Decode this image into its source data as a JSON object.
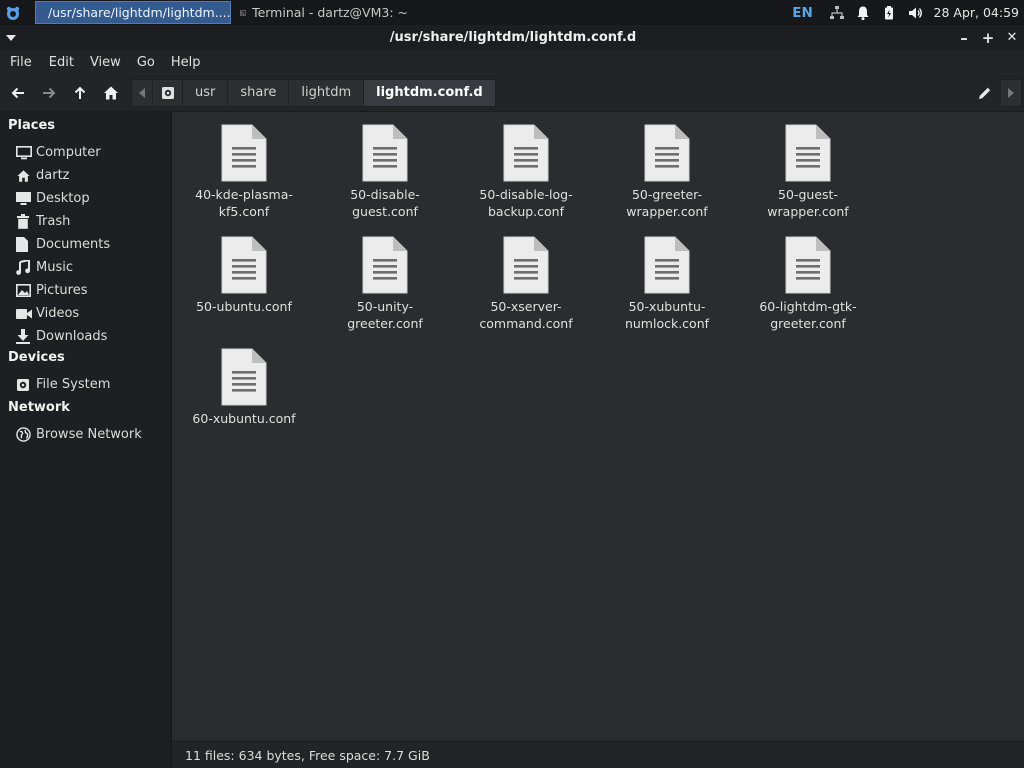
{
  "panel": {
    "active_task": "/usr/share/lightdm/lightdm....",
    "inactive_task": "Terminal - dartz@VM3: ~",
    "keyboard_layout": "EN",
    "clock": "28 Apr, 04:59"
  },
  "window": {
    "title": "/usr/share/lightdm/lightdm.conf.d",
    "minimize": "–",
    "maximize": "+",
    "close": "✕"
  },
  "menubar": [
    "File",
    "Edit",
    "View",
    "Go",
    "Help"
  ],
  "pathbar": {
    "crumbs": [
      "usr",
      "share",
      "lightdm",
      "lightdm.conf.d"
    ]
  },
  "sidebar": {
    "places_heading": "Places",
    "places": [
      {
        "label": "Computer",
        "icon": "computer-icon"
      },
      {
        "label": "dartz",
        "icon": "home-icon"
      },
      {
        "label": "Desktop",
        "icon": "desktop-icon"
      },
      {
        "label": "Trash",
        "icon": "trash-icon"
      },
      {
        "label": "Documents",
        "icon": "documents-icon"
      },
      {
        "label": "Music",
        "icon": "music-icon"
      },
      {
        "label": "Pictures",
        "icon": "pictures-icon"
      },
      {
        "label": "Videos",
        "icon": "videos-icon"
      },
      {
        "label": "Downloads",
        "icon": "downloads-icon"
      }
    ],
    "devices_heading": "Devices",
    "devices": [
      {
        "label": "File System",
        "icon": "drive-icon"
      }
    ],
    "network_heading": "Network",
    "network": [
      {
        "label": "Browse Network",
        "icon": "network-icon"
      }
    ]
  },
  "files": [
    "40-kde-plasma-kf5.conf",
    "50-disable-guest.conf",
    "50-disable-log-backup.conf",
    "50-greeter-wrapper.conf",
    "50-guest-wrapper.conf",
    "50-ubuntu.conf",
    "50-unity-greeter.conf",
    "50-xserver-command.conf",
    "50-xubuntu-numlock.conf",
    "60-lightdm-gtk-greeter.conf",
    "60-xubuntu.conf"
  ],
  "file_display_names": [
    [
      "40-kde-plasma-",
      "kf5.conf"
    ],
    [
      "50-disable-guest.conf"
    ],
    [
      "50-disable-log-",
      "backup.conf"
    ],
    [
      "50-greeter-",
      "wrapper.conf"
    ],
    [
      "50-guest-wrapper.conf"
    ],
    [
      "50-ubuntu.conf"
    ],
    [
      "50-unity-greeter.conf"
    ],
    [
      "50-xserver-",
      "command.conf"
    ],
    [
      "50-xubuntu-",
      "numlock.conf"
    ],
    [
      "60-lightdm-gtk-",
      "greeter.conf"
    ],
    [
      "60-xubuntu.conf"
    ]
  ],
  "statusbar": {
    "text": "11 files: 634 bytes, Free space: 7.7 GiB"
  },
  "colors": {
    "accent": "#345a8e",
    "panel_bg": "#17181b",
    "window_bg": "#2b2c30",
    "sidebar_bg": "#1e1f22",
    "keyboard_layout_text": "#58a6e8"
  }
}
